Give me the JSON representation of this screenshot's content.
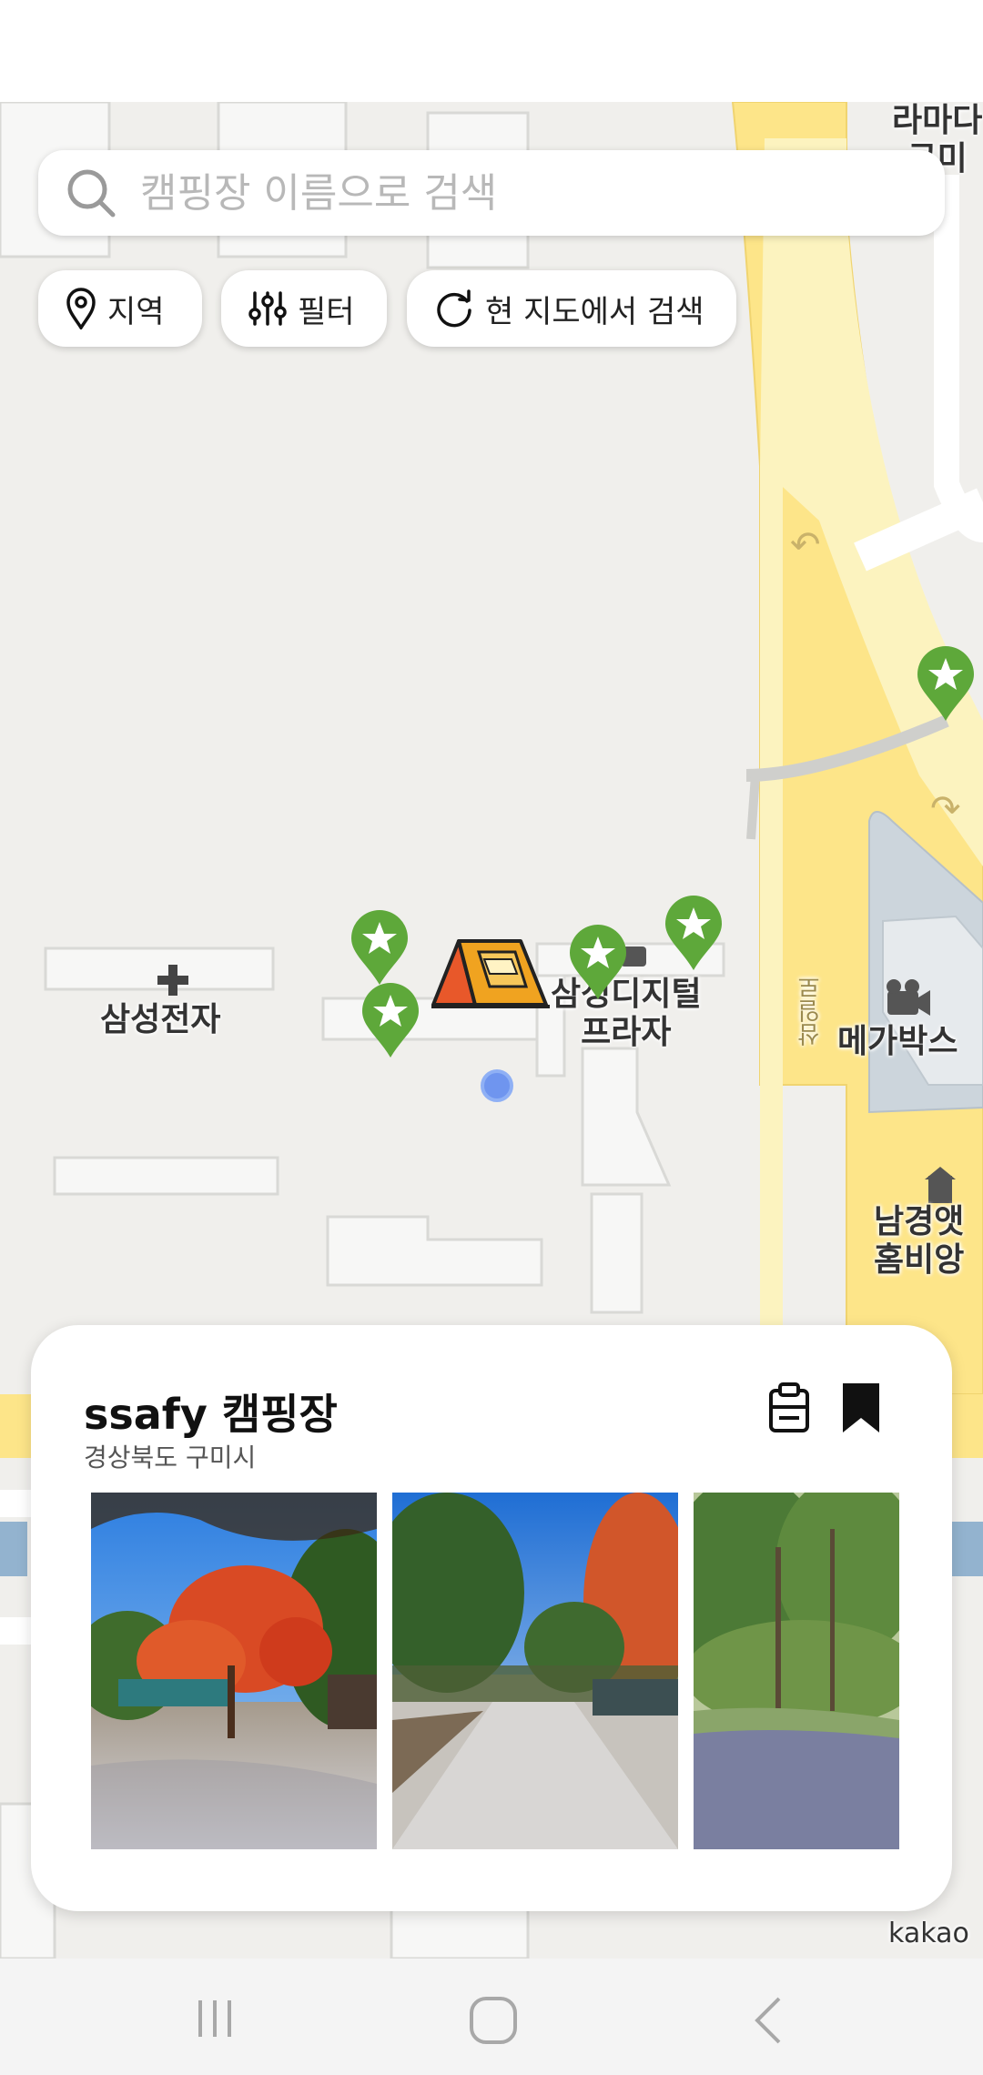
{
  "search": {
    "placeholder": "캠핑장 이름으로 검색"
  },
  "chips": [
    {
      "label": "지역",
      "icon": "location-pin-icon"
    },
    {
      "label": "필터",
      "icon": "sliders-icon"
    },
    {
      "label": "현 지도에서 검색",
      "icon": "refresh-icon"
    }
  ],
  "map": {
    "labels": {
      "samsung": "삼성전자",
      "plaza1": "삼성디지털",
      "plaza2": "프라자",
      "megabox": "메가박스",
      "namgyeong1": "남경앳",
      "namgyeong2": "홈비앙",
      "ramada1": "라마다",
      "ramada2": "구미",
      "road": "삼일로",
      "provider": "kakao"
    }
  },
  "campsite": {
    "name": "ssafy 캠핑장",
    "region": "경상북도 구미시"
  },
  "colors": {
    "marker": "#5ea83a",
    "road": "#fde589",
    "accent": "#111111"
  }
}
